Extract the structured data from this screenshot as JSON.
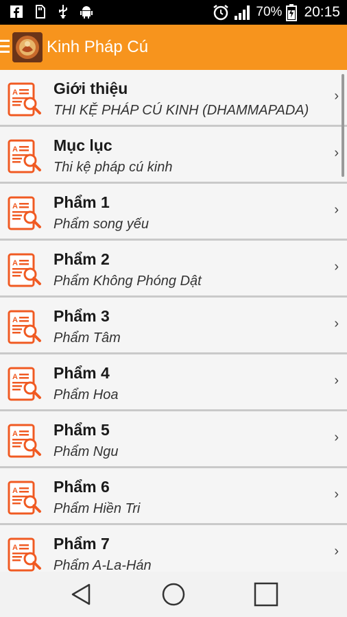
{
  "status_bar": {
    "battery": "70%",
    "time": "20:15",
    "icons": [
      "facebook-icon",
      "sd-card-icon",
      "usb-icon",
      "android-icon",
      "alarm-icon",
      "signal-icon",
      "battery-icon"
    ]
  },
  "app_bar": {
    "title": "Kinh Pháp Cú"
  },
  "list": {
    "items": [
      {
        "title": "Giới thiệu",
        "subtitle": "THI KỆ PHÁP CÚ KINH (DHAMMAPADA)"
      },
      {
        "title": "Mục lục",
        "subtitle": "Thi kệ pháp cú kinh"
      },
      {
        "title": "Phẩm 1",
        "subtitle": "Phẩm song yếu"
      },
      {
        "title": "Phẩm 2",
        "subtitle": "Phẩm Không Phóng Dật"
      },
      {
        "title": "Phẩm 3",
        "subtitle": "Phẩm Tâm"
      },
      {
        "title": "Phẩm 4",
        "subtitle": "Phẩm Hoa"
      },
      {
        "title": "Phẩm 5",
        "subtitle": "Phẩm Ngu"
      },
      {
        "title": "Phẩm 6",
        "subtitle": "Phẩm Hiền Tri"
      },
      {
        "title": "Phẩm 7",
        "subtitle": "Phẩm A-La-Hán"
      }
    ],
    "chevron": "›"
  },
  "colors": {
    "app_bar": "#f7941d",
    "icon_accent": "#f05a22"
  }
}
